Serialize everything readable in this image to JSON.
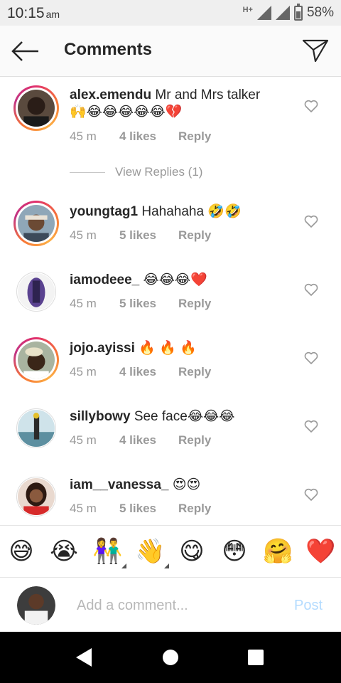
{
  "status_bar": {
    "time": "10:15",
    "ampm": "am",
    "network": "H+",
    "battery_percent": "58%"
  },
  "header": {
    "title": "Comments"
  },
  "comments": [
    {
      "username": "alex.emendu",
      "text": "Mr and Mrs talker",
      "emoji": "🙌😂😂😂😂😂💔",
      "time": "45 m",
      "likes": "4 likes",
      "reply": "Reply",
      "view_replies": "View Replies (1)"
    },
    {
      "username": "youngtag1",
      "text": "Hahahaha",
      "emoji": "🤣🤣",
      "time": "45 m",
      "likes": "5 likes",
      "reply": "Reply"
    },
    {
      "username": "iamodeee_",
      "text": "",
      "emoji": "😂😂😂❤️",
      "time": "45 m",
      "likes": "5 likes",
      "reply": "Reply"
    },
    {
      "username": "jojo.ayissi",
      "text": "",
      "emoji": "🔥 🔥 🔥",
      "time": "45 m",
      "likes": "4 likes",
      "reply": "Reply"
    },
    {
      "username": "sillybowy",
      "text": "See face",
      "emoji": "😂😂😂",
      "time": "45 m",
      "likes": "4 likes",
      "reply": "Reply"
    },
    {
      "username": "iam__vanessa_",
      "text": "",
      "emoji": "😍😍",
      "time": "45 m",
      "likes": "5 likes",
      "reply": "Reply"
    }
  ],
  "emoji_bar": [
    "😅",
    "😭",
    "👫",
    "👋",
    "😋",
    "😳",
    "🤗",
    "❤️"
  ],
  "composer": {
    "placeholder": "Add a comment...",
    "post_label": "Post"
  },
  "colors": {
    "accent_post": "#b3dbff",
    "meta_grey": "#999999",
    "story_ring": "#e1306c"
  }
}
